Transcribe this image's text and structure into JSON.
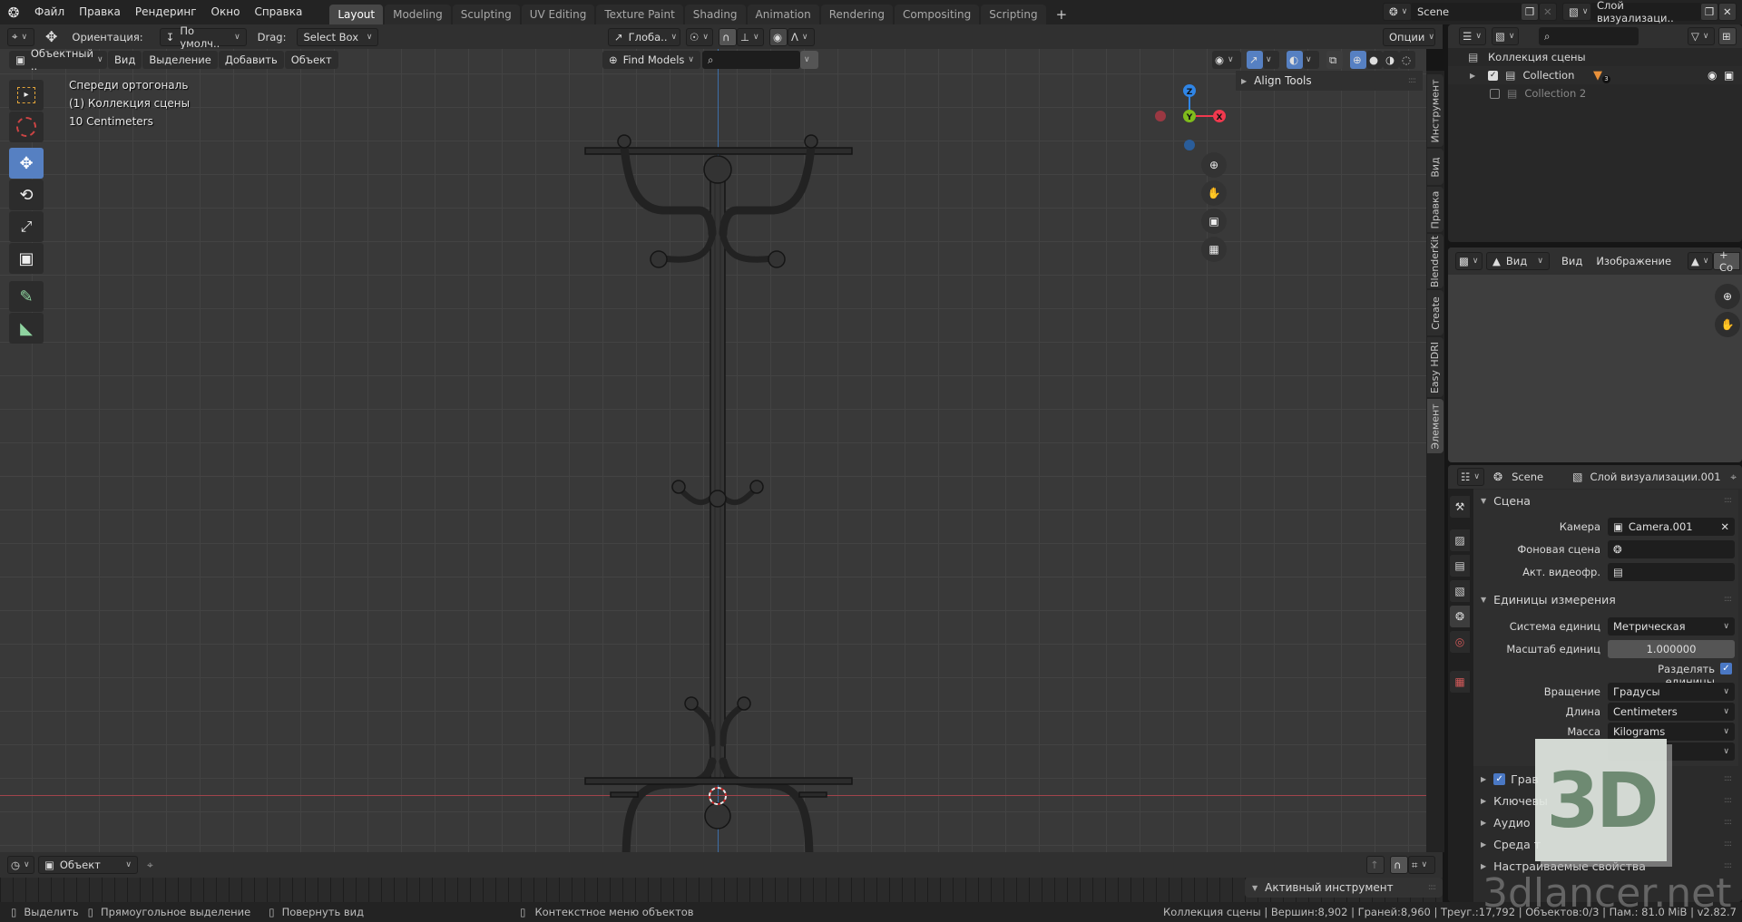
{
  "app": {
    "logo_icon": "blender-logo-icon"
  },
  "menu": [
    "Файл",
    "Правка",
    "Рендеринг",
    "Окно",
    "Справка"
  ],
  "workspaces": [
    {
      "label": "Layout",
      "active": true
    },
    {
      "label": "Modeling"
    },
    {
      "label": "Sculpting"
    },
    {
      "label": "UV Editing"
    },
    {
      "label": "Texture Paint"
    },
    {
      "label": "Shading"
    },
    {
      "label": "Animation"
    },
    {
      "label": "Rendering"
    },
    {
      "label": "Compositing"
    },
    {
      "label": "Scripting"
    }
  ],
  "add_workspace": "+",
  "scene_selector": {
    "value": "Scene"
  },
  "view_layer_selector": {
    "value": "Слой визуализаци.."
  },
  "tool_header": {
    "orientation_label": "Ориентация:",
    "orientation_value": "По умолч..",
    "drag_label": "Drag:",
    "drag_value": "Select Box",
    "transform_orientation": "Глоба..",
    "options": "Опции"
  },
  "viewport_header": {
    "mode": "Объектный ..",
    "menus": [
      "Вид",
      "Выделение",
      "Добавить",
      "Объект"
    ],
    "find_models": "Find Models",
    "search_placeholder": ""
  },
  "viewport_overlay": {
    "view_name": "Спереди ортогональ",
    "collection": "(1) Коллекция сцены",
    "scale": "10 Centimeters"
  },
  "gizmo": {
    "z": "Z",
    "y": "Y",
    "x": "X",
    "colors": {
      "x": "#f0394e",
      "y": "#7fbc1c",
      "z": "#2f85e6"
    }
  },
  "align_tools": "Align Tools",
  "n_panel_tabs": [
    "Инструмент",
    "Вид",
    "Правка",
    "BlenderKit",
    "Create",
    "Easy HDRI",
    "Элемент"
  ],
  "outliner": {
    "root": "Коллекция сцены",
    "items": [
      {
        "name": "Collection",
        "checked": true,
        "badge": "3"
      },
      {
        "name": "Collection 2",
        "checked": false
      }
    ]
  },
  "image_editor": {
    "view_dropdown": "Вид",
    "menus": [
      "Вид",
      "Изображение"
    ],
    "new_button": "+ Co"
  },
  "properties": {
    "breadcrumb_scene": "Scene",
    "breadcrumb_layer": "Слой визуализации.001",
    "scene_section": "Сцена",
    "camera_label": "Камера",
    "camera_value": "Camera.001",
    "bg_scene_label": "Фоновая сцена",
    "bg_scene_value": "",
    "active_clip_label": "Акт. видеофр.",
    "active_clip_value": "",
    "units_section": "Единицы измерения",
    "unit_system_label": "Система единиц",
    "unit_system_value": "Метрическая",
    "unit_scale_label": "Масштаб единиц",
    "unit_scale_value": "1.000000",
    "separate_units_label": "Разделять единицы",
    "separate_units_checked": true,
    "rotation_label": "Вращение",
    "rotation_value": "Градусы",
    "length_label": "Длина",
    "length_value": "Centimeters",
    "mass_label": "Масса",
    "mass_value": "Kilograms",
    "collapsed_sections": [
      "Грав",
      "Ключевы",
      "Аудио",
      "Среда т",
      "Настраиваемые свойства"
    ]
  },
  "timeline": {
    "editor_mode": "Объект",
    "active_tool_panel": "Активный инструмент"
  },
  "statusbar": {
    "hints": [
      "Выделить",
      "Прямоугольное выделение",
      "Повернуть вид",
      "Контекстное меню объектов"
    ],
    "stats": "Коллекция сцены | Вершин:8,902 | Граней:8,960 | Треуг.:17,792 | Объектов:0/3 | Пам.: 81.0 MiB | v2.82.7"
  },
  "watermark": {
    "logo": "3D",
    "site": "3dlancer.net"
  },
  "accent_color": "#5680c2"
}
